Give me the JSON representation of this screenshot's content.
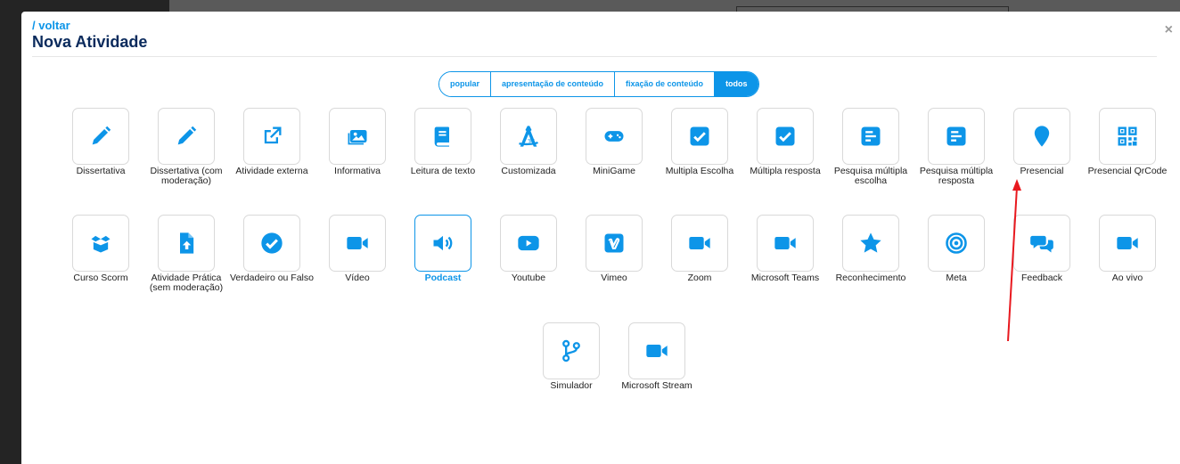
{
  "header": {
    "back_label": "/ voltar",
    "title": "Nova Atividade",
    "close_label": "×"
  },
  "filters": [
    {
      "label": "popular",
      "active": false
    },
    {
      "label": "apresentação de conteúdo",
      "active": false
    },
    {
      "label": "fixação de conteúdo",
      "active": false
    },
    {
      "label": "todos",
      "active": true
    }
  ],
  "accent_color": "#0d95e8",
  "annotation_color": "#e8191f",
  "activities": [
    {
      "label": "Dissertativa",
      "icon": "pencil-icon"
    },
    {
      "label": "Dissertativa (com moderação)",
      "icon": "pencil-icon"
    },
    {
      "label": "Atividade externa",
      "icon": "external-link-icon"
    },
    {
      "label": "Informativa",
      "icon": "images-icon"
    },
    {
      "label": "Leitura de texto",
      "icon": "book-icon"
    },
    {
      "label": "Customizada",
      "icon": "drafting-compass-icon"
    },
    {
      "label": "MiniGame",
      "icon": "gamepad-icon"
    },
    {
      "label": "Multipla Escolha",
      "icon": "checkbox-icon"
    },
    {
      "label": "Múltipla resposta",
      "icon": "checkbox-icon"
    },
    {
      "label": "Pesquisa múltipla escolha",
      "icon": "poll-icon"
    },
    {
      "label": "Pesquisa múltipla resposta",
      "icon": "poll-icon"
    },
    {
      "label": "Presencial",
      "icon": "map-marker-icon"
    },
    {
      "label": "Presencial QrCode",
      "icon": "qrcode-icon"
    },
    {
      "label": "Curso Scorm",
      "icon": "box-open-icon"
    },
    {
      "label": "Atividade Prática (sem moderação)",
      "icon": "file-upload-icon"
    },
    {
      "label": "Verdadeiro ou Falso",
      "icon": "check-circle-icon"
    },
    {
      "label": "Vídeo",
      "icon": "video-icon"
    },
    {
      "label": "Podcast",
      "icon": "volume-icon",
      "selected": true
    },
    {
      "label": "Youtube",
      "icon": "youtube-icon"
    },
    {
      "label": "Vimeo",
      "icon": "vimeo-icon"
    },
    {
      "label": "Zoom",
      "icon": "video-icon"
    },
    {
      "label": "Microsoft Teams",
      "icon": "video-icon"
    },
    {
      "label": "Reconhecimento",
      "icon": "star-icon"
    },
    {
      "label": "Meta",
      "icon": "bullseye-icon"
    },
    {
      "label": "Feedback",
      "icon": "comments-icon"
    },
    {
      "label": "Ao vivo",
      "icon": "video-icon"
    },
    {
      "label": "Simulador",
      "icon": "code-branch-icon"
    },
    {
      "label": "Microsoft Stream",
      "icon": "video-icon"
    }
  ]
}
